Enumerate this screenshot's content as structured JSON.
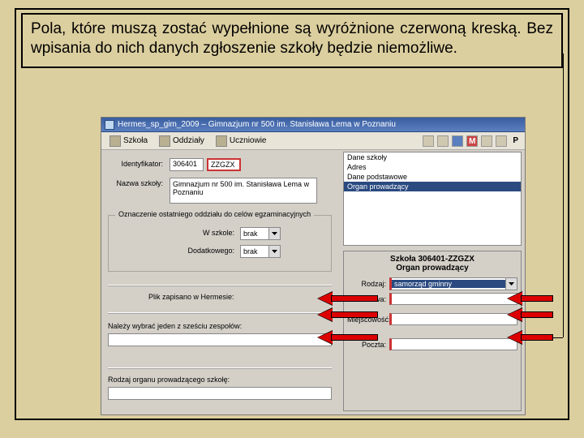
{
  "instruction": "Pola, które muszą zostać wypełnione są wyróżnione czerwoną kreską. Bez wpisania do nich danych zgłoszenie szkoły będzie niemożliwe.",
  "window": {
    "title": "Hermes_sp_gim_2009 – Gimnazjum nr 500 im. Stanisława Lema w Poznaniu"
  },
  "toolbar": {
    "szkola": "Szkoła",
    "oddzialy": "Oddziały",
    "uczniowie": "Uczniowie",
    "p": "P"
  },
  "form": {
    "id_label": "Identyfikator:",
    "id_part1": "306401",
    "id_part2": "ZZGZX",
    "name_label": "Nazwa szkoły:",
    "name_value": "Gimnazjum nr 500 im. Stanisława Lema w Poznaniu",
    "fieldset_legend": "Oznaczenie ostatniego oddziału do celów egzaminacyjnych",
    "wszkole_label": "W szkole:",
    "dodatkowego_label": "Dodatkowego:",
    "dd_value": "brak",
    "plik_label": "Plik zapisano w Hermesie:",
    "wybrac_note": "Należy wybrać jeden z sześciu zespołów:",
    "rodzaj_label": "Rodzaj organu prowadzącego szkołę:"
  },
  "listbox": {
    "items": [
      "Dane szkoły",
      "Adres",
      "Dane podstawowe",
      "Organ prowadzący"
    ],
    "selected": 3
  },
  "rightform": {
    "heading1": "Szkoła 306401-ZZGZX",
    "heading2": "Organ prowadzący",
    "rodzaj_label": "Rodzaj:",
    "rodzaj_value": "samorząd gminny",
    "nazwa_label": "Nazwa:",
    "miejscowosc_label": "Miejscowość:",
    "poczta_label": "Poczta:"
  }
}
